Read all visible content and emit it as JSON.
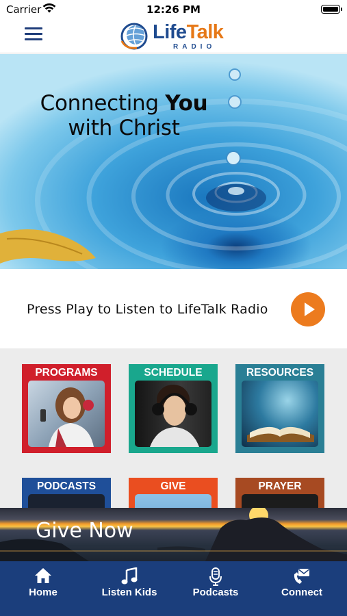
{
  "status_bar": {
    "carrier": "Carrier",
    "time": "12:26 PM"
  },
  "header": {
    "logo_life": "Life",
    "logo_talk": "Talk",
    "logo_radio": "RADIO",
    "colors": {
      "navy": "#1f4b8f",
      "orange": "#e67817"
    }
  },
  "hero": {
    "line1_prefix": "Connecting ",
    "line1_bold": "You",
    "line2": "with Christ"
  },
  "play": {
    "label": "Press Play to Listen to LifeTalk Radio",
    "button_color": "#ec7b1e"
  },
  "tiles": [
    {
      "label": "PROGRAMS",
      "color": "#d01f2b"
    },
    {
      "label": "SCHEDULE",
      "color": "#19a78d"
    },
    {
      "label": "RESOURCES",
      "color": "#2a7f95"
    },
    {
      "label": "PODCASTS",
      "color": "#1f4f99"
    },
    {
      "label": "GIVE",
      "color": "#ea4e20"
    },
    {
      "label": "PRAYER",
      "color": "#a74a22"
    }
  ],
  "give_banner": {
    "label": "Give Now"
  },
  "tabbar": {
    "items": [
      {
        "label": "Home",
        "icon": "home-icon"
      },
      {
        "label": "Listen Kids",
        "icon": "music-note-icon"
      },
      {
        "label": "Podcasts",
        "icon": "microphone-icon"
      },
      {
        "label": "Connect",
        "icon": "phone-mail-icon"
      }
    ],
    "color": "#1b3e7c"
  }
}
